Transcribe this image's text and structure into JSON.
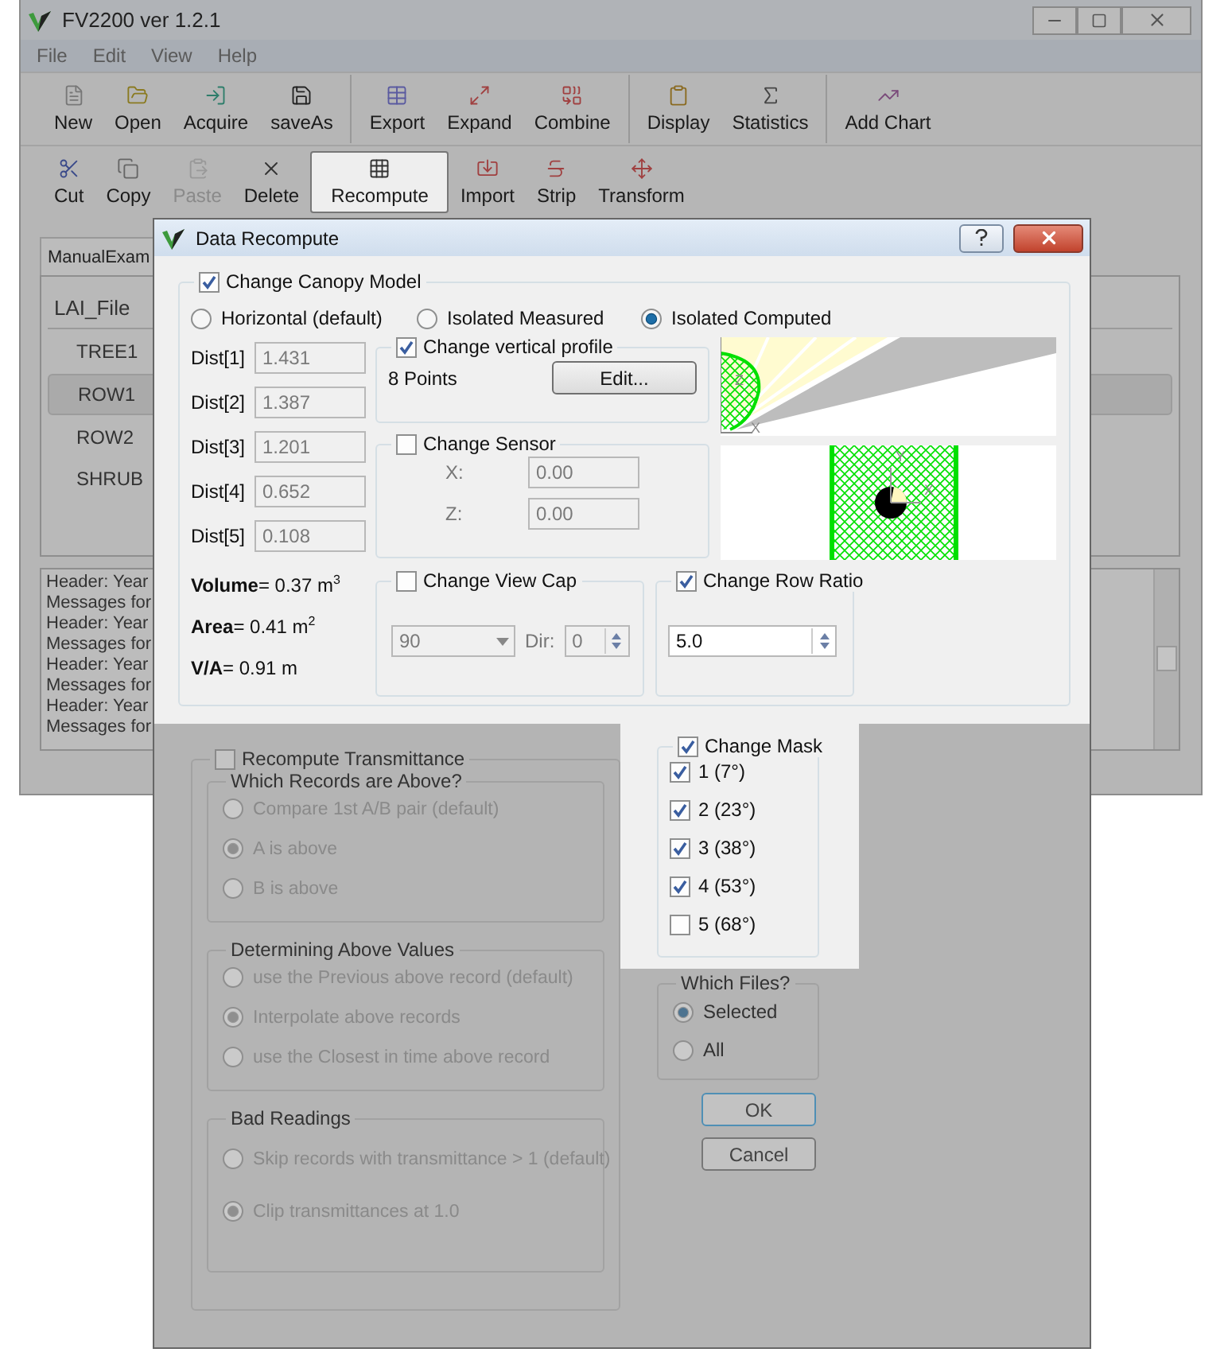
{
  "window": {
    "title": "FV2200 ver 1.2.1"
  },
  "menu": [
    "File",
    "Edit",
    "View",
    "Help"
  ],
  "toolbars": [
    {
      "groups": [
        [
          {
            "label": "New",
            "kind": "new",
            "disabled": false,
            "pressed": false
          },
          {
            "label": "Open",
            "kind": "open",
            "disabled": false,
            "pressed": false
          },
          {
            "label": "Acquire",
            "kind": "acquire",
            "disabled": false,
            "pressed": false
          },
          {
            "label": "saveAs",
            "kind": "save",
            "disabled": false,
            "pressed": false
          }
        ],
        [
          {
            "label": "Export",
            "kind": "export",
            "disabled": false,
            "pressed": false
          },
          {
            "label": "Expand",
            "kind": "expand",
            "disabled": false,
            "pressed": false
          },
          {
            "label": "Combine",
            "kind": "combine",
            "disabled": false,
            "pressed": false
          }
        ],
        [
          {
            "label": "Display",
            "kind": "display",
            "disabled": false,
            "pressed": false
          },
          {
            "label": "Statistics",
            "kind": "statistics",
            "disabled": false,
            "pressed": false
          }
        ],
        [
          {
            "label": "Add Chart",
            "kind": "chart",
            "disabled": false,
            "pressed": false
          }
        ]
      ]
    },
    {
      "groups": [
        [
          {
            "label": "Cut",
            "kind": "cut",
            "disabled": false,
            "pressed": false
          },
          {
            "label": "Copy",
            "kind": "copy",
            "disabled": false,
            "pressed": false
          },
          {
            "label": "Paste",
            "kind": "paste",
            "disabled": true,
            "pressed": false
          },
          {
            "label": "Delete",
            "kind": "delete",
            "disabled": false,
            "pressed": false
          },
          {
            "label": "Recompute",
            "kind": "recompute",
            "disabled": false,
            "pressed": true
          },
          {
            "label": "Import",
            "kind": "import",
            "disabled": false,
            "pressed": false
          },
          {
            "label": "Strip",
            "kind": "strip",
            "disabled": false,
            "pressed": false
          },
          {
            "label": "Transform",
            "kind": "transform",
            "disabled": false,
            "pressed": false
          }
        ]
      ]
    }
  ],
  "file_tab": {
    "label": "ManualExam"
  },
  "file_list": {
    "header": "LAI_File",
    "rows": [
      {
        "label": "TREE1",
        "selected": false
      },
      {
        "label": "ROW1",
        "selected": true
      },
      {
        "label": "ROW2",
        "selected": false
      },
      {
        "label": "SHRUB",
        "selected": false
      }
    ]
  },
  "messages": [
    "Header: Year",
    "Messages for",
    "Header: Year",
    "Messages for",
    "Header: Year",
    "Messages for",
    "Header: Year",
    "Messages for"
  ],
  "dialog": {
    "title": "Data Recompute",
    "canopy": {
      "label": "Change Canopy Model",
      "checked": true,
      "models": [
        {
          "label": "Horizontal (default)",
          "selected": false
        },
        {
          "label": "Isolated Measured",
          "selected": false
        },
        {
          "label": "Isolated Computed",
          "selected": true
        }
      ],
      "distances": [
        {
          "label": "Dist[1]",
          "value": "1.431"
        },
        {
          "label": "Dist[2]",
          "value": "1.387"
        },
        {
          "label": "Dist[3]",
          "value": "1.201"
        },
        {
          "label": "Dist[4]",
          "value": "0.652"
        },
        {
          "label": "Dist[5]",
          "value": "0.108"
        }
      ],
      "stats": [
        "**Volume**= 0.37 m$^{3}$",
        "**Area**= 0.41 m$^{2}$",
        "**V/A**= 0.91 m"
      ],
      "vertical_profile": {
        "label": "Change vertical profile",
        "checked": true,
        "points": "8 Points",
        "button": "Edit..."
      },
      "sensor": {
        "label": "Change Sensor",
        "checked": false,
        "fields": [
          {
            "label": "X:",
            "value": "0.00"
          },
          {
            "label": "Z:",
            "value": "0.00"
          }
        ]
      },
      "side_view_axes": [
        "Z",
        "X"
      ],
      "top_view_axes": [
        "Y",
        "X"
      ],
      "view_cap": {
        "label": "Change View Cap",
        "checked": false,
        "angle": "90",
        "dir_label": "Dir:",
        "dir": "0"
      },
      "row_ratio": {
        "label": "Change Row Ratio",
        "checked": true,
        "value": "5.0"
      }
    },
    "transmittance": {
      "label": "Recompute Transmittance",
      "checked": false,
      "groups": [
        {
          "title": "Which Records are Above?",
          "options": [
            {
              "label": "Compare 1st A/B pair (default)",
              "selected": false
            },
            {
              "label": "A is above",
              "selected": true
            },
            {
              "label": "B is above",
              "selected": false
            }
          ]
        },
        {
          "title": "Determining Above Values",
          "options": [
            {
              "label": "use the Previous above record (default)",
              "selected": false
            },
            {
              "label": "Interpolate above records",
              "selected": true
            },
            {
              "label": "use the Closest in time above record",
              "selected": false
            }
          ]
        },
        {
          "title": "Bad Readings",
          "options": [
            {
              "label": "Skip records with transmittance > 1 (default)",
              "selected": false
            },
            {
              "label": "Clip transmittances at 1.0",
              "selected": true
            }
          ]
        }
      ]
    },
    "mask": {
      "label": "Change Mask",
      "checked": true,
      "rings": [
        {
          "label": "1 (7°)",
          "checked": true
        },
        {
          "label": "2 (23°)",
          "checked": true
        },
        {
          "label": "3 (38°)",
          "checked": true
        },
        {
          "label": "4 (53°)",
          "checked": true
        },
        {
          "label": "5 (68°)",
          "checked": false
        }
      ]
    },
    "files": {
      "title": "Which Files?",
      "options": [
        {
          "label": "Selected",
          "selected": true
        },
        {
          "label": "All",
          "selected": false
        }
      ]
    },
    "buttons": [
      {
        "label": "OK",
        "default": true
      },
      {
        "label": "Cancel",
        "default": false
      }
    ]
  }
}
